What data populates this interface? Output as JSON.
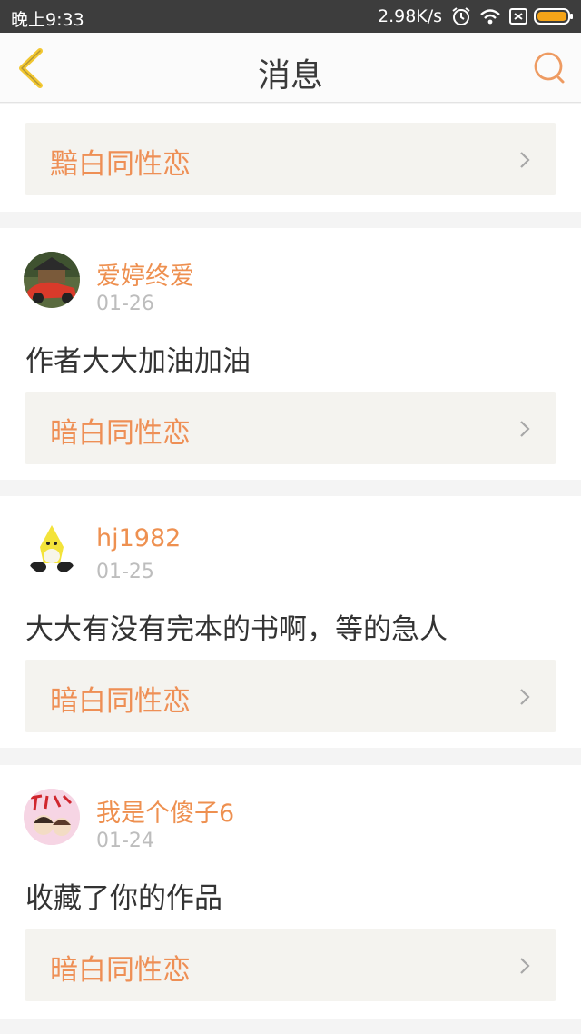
{
  "status_bar": {
    "time": "晚上9:33",
    "net_speed": "2.98K/s",
    "icons": [
      "alarm-icon",
      "wifi-icon",
      "sim-icon",
      "battery-icon"
    ]
  },
  "header": {
    "title": "消息",
    "back_icon": "back-chevron-icon",
    "search_icon": "search-icon"
  },
  "colors": {
    "accent": "#ee8f55",
    "link_bg": "#f4f3ef",
    "page_bg": "#f4f4f4",
    "status_bg": "#3d3d3d",
    "battery": "#f5a418"
  },
  "first_card": {
    "link_label": "黯白同性恋"
  },
  "messages": [
    {
      "username": "爱婷终爱",
      "date": "01-26",
      "text": "作者大大加油加油",
      "link_label": "暗白同性恋"
    },
    {
      "username": "hj1982",
      "date": "01-25",
      "text": "大大有没有完本的书啊，等的急人",
      "link_label": "暗白同性恋"
    },
    {
      "username": "我是个傻子6",
      "date": "01-24",
      "text": "收藏了你的作品",
      "link_label": "暗白同性恋"
    }
  ]
}
